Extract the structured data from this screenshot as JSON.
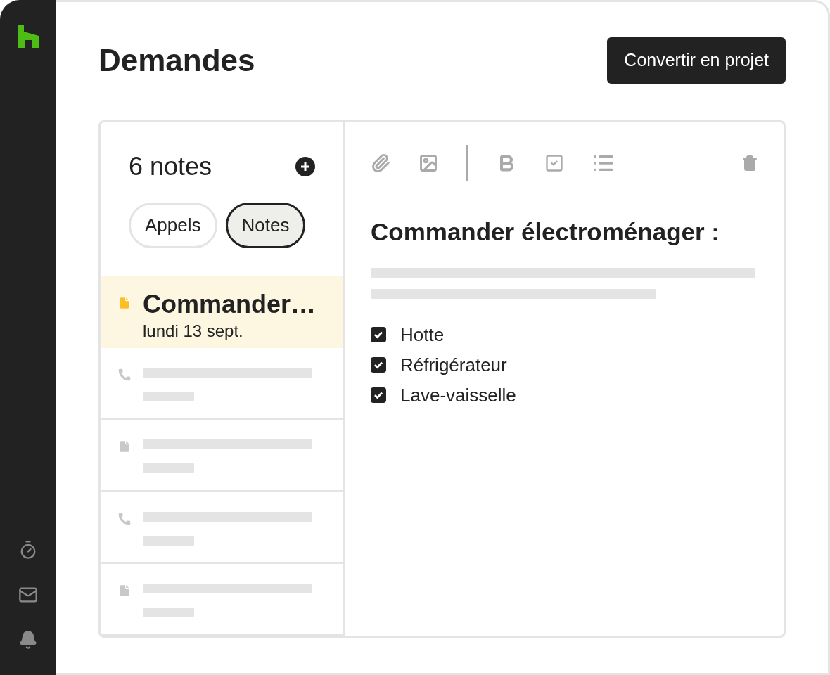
{
  "page": {
    "title": "Demandes",
    "action_button": "Convertir en projet"
  },
  "notes_panel": {
    "count": "6 notes",
    "tabs": [
      {
        "label": "Appels",
        "selected": false
      },
      {
        "label": "Notes",
        "selected": true
      }
    ],
    "items": [
      {
        "kind": "note",
        "selected": true,
        "title": "Commander…",
        "date": "lundi 13 sept."
      },
      {
        "kind": "call",
        "selected": false
      },
      {
        "kind": "note",
        "selected": false
      },
      {
        "kind": "call",
        "selected": false
      },
      {
        "kind": "note",
        "selected": false
      }
    ]
  },
  "editor": {
    "heading": "Commander électroménager :",
    "checklist": [
      {
        "label": "Hotte",
        "checked": true
      },
      {
        "label": "Réfrigérateur",
        "checked": true
      },
      {
        "label": "Lave-vaisselle",
        "checked": true
      }
    ]
  }
}
